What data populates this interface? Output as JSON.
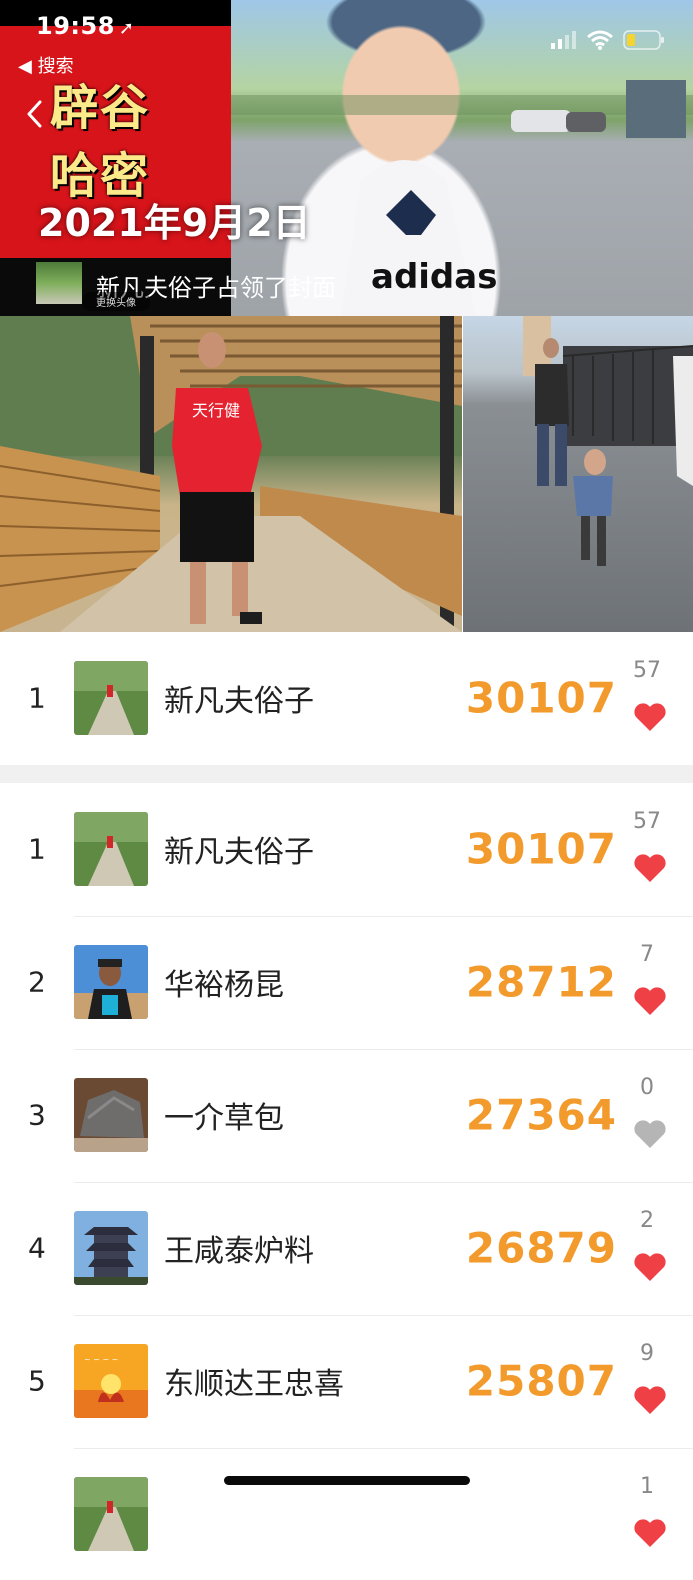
{
  "status_bar": {
    "time": "19:58",
    "back_label": "◀ 搜索"
  },
  "cover": {
    "title_line1": "辟谷",
    "title_line2": "哈密",
    "date": "2021年9月2日",
    "caption": "新凡夫俗子占领了封面",
    "change_avatar": "更换头像"
  },
  "top_entry": {
    "rank": "1",
    "name": "新凡夫俗子",
    "score": "30107",
    "likes": "57",
    "liked": true
  },
  "ranking": [
    {
      "rank": "1",
      "name": "新凡夫俗子",
      "score": "30107",
      "likes": "57",
      "liked": true,
      "avatar": "path-photo"
    },
    {
      "rank": "2",
      "name": "华裕杨昆",
      "score": "28712",
      "likes": "7",
      "liked": true,
      "avatar": "runner-photo"
    },
    {
      "rank": "3",
      "name": "一介草包",
      "score": "27364",
      "likes": "0",
      "liked": false,
      "avatar": "rock-photo"
    },
    {
      "rank": "4",
      "name": "王咸泰炉料",
      "score": "26879",
      "likes": "2",
      "liked": true,
      "avatar": "pagoda-photo"
    },
    {
      "rank": "5",
      "name": "东顺达王忠喜",
      "score": "25807",
      "likes": "9",
      "liked": true,
      "avatar": "swans-photo"
    },
    {
      "rank": "",
      "name": "",
      "score": "",
      "likes": "1",
      "liked": true,
      "avatar": "path-photo"
    }
  ],
  "colors": {
    "score": "#f39a2d",
    "heart_liked": "#ef4046",
    "heart_unliked": "#b5b5b5",
    "cover_red": "#d7141a"
  }
}
